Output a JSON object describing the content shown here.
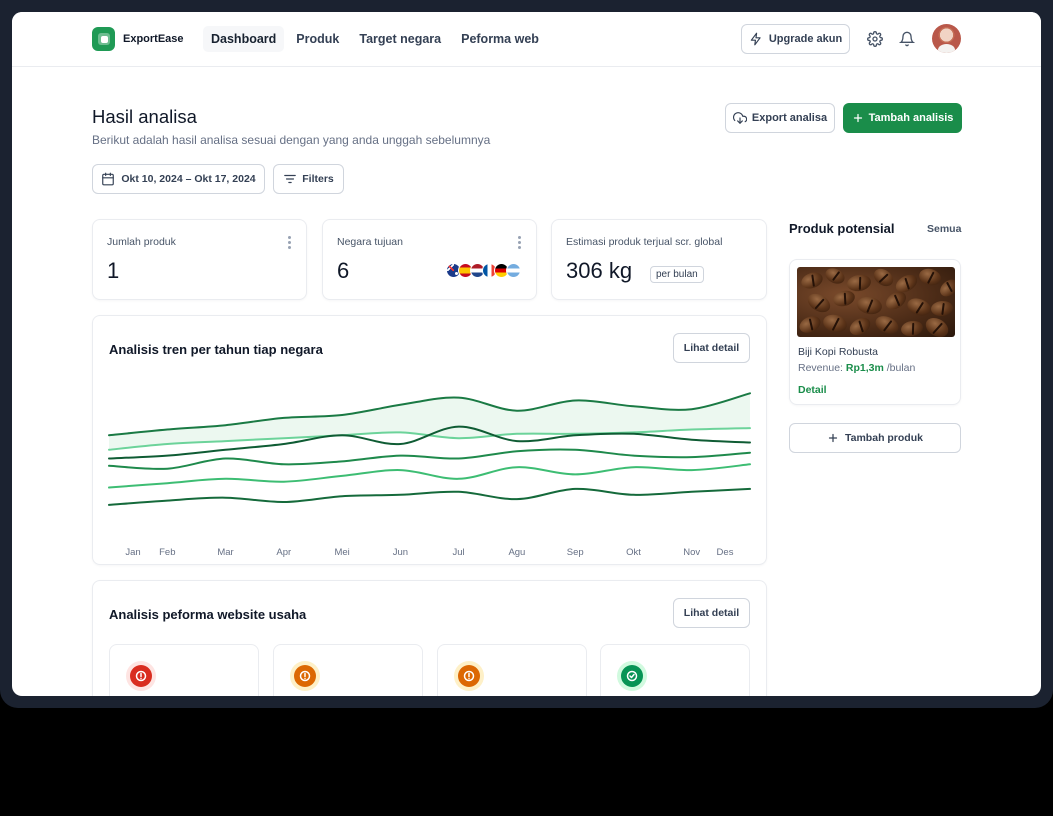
{
  "app": {
    "name": "ExportEase"
  },
  "nav": {
    "links": [
      {
        "label": "Dashboard",
        "active": true
      },
      {
        "label": "Produk",
        "active": false
      },
      {
        "label": "Target negara",
        "active": false
      },
      {
        "label": "Peforma web",
        "active": false
      }
    ],
    "upgrade_label": "Upgrade akun",
    "icons": [
      "settings-icon",
      "bell-icon"
    ]
  },
  "header": {
    "title": "Hasil analisa",
    "subtitle": "Berikut adalah hasil analisa sesuai dengan yang anda unggah sebelumnya",
    "export_label": "Export analisa",
    "add_label": "Tambah analisis",
    "date_range": "Okt 10, 2024 – Okt 17, 2024",
    "filters_label": "Filters"
  },
  "stats": [
    {
      "label": "Jumlah produk",
      "value": "1"
    },
    {
      "label": "Negara tujuan",
      "value": "6",
      "flags": [
        "australia",
        "spain",
        "netherlands",
        "france",
        "germany",
        "argentina"
      ]
    },
    {
      "label": "Estimasi produk terjual scr. global",
      "value": "306 kg",
      "unit_badge": "per bulan"
    }
  ],
  "trend": {
    "title": "Analisis tren per tahun tiap negara",
    "detail_label": "Lihat detail"
  },
  "chart_data": {
    "type": "line",
    "title": "Analisis tren per tahun tiap negara",
    "x": [
      "Jan",
      "Feb",
      "Mar",
      "Apr",
      "Mei",
      "Jun",
      "Jul",
      "Agu",
      "Sep",
      "Okt",
      "Nov",
      "Des"
    ],
    "ylim": [
      0,
      100
    ],
    "grid": false,
    "series": [
      {
        "color": "#1a7a44",
        "values": [
          66,
          70,
          73,
          78,
          80,
          87,
          92,
          83,
          90,
          86,
          84,
          95
        ]
      },
      {
        "color": "#6cd39a",
        "values": [
          56,
          60,
          62,
          64,
          66,
          68,
          64,
          67,
          67,
          68,
          70,
          71
        ]
      },
      {
        "color": "#0f5c34",
        "values": [
          50,
          52,
          56,
          60,
          66,
          60,
          72,
          62,
          66,
          67,
          63,
          61
        ]
      },
      {
        "color": "#1f8a4c",
        "values": [
          45,
          43,
          50,
          46,
          48,
          52,
          50,
          55,
          56,
          52,
          51,
          54
        ]
      },
      {
        "color": "#3dbd73",
        "values": [
          30,
          33,
          36,
          34,
          38,
          42,
          36,
          44,
          39,
          44,
          42,
          46
        ]
      },
      {
        "color": "#156a3b",
        "values": [
          18,
          21,
          23,
          20,
          24,
          25,
          27,
          22,
          29,
          25,
          27,
          29
        ]
      }
    ]
  },
  "web_perf": {
    "title": "Analisis peforma website usaha",
    "detail_label": "Lihat detail",
    "cards": [
      {
        "status": "error",
        "color": "#d92d20",
        "bg": "#fee4e2",
        "icon": "alert-circle-icon"
      },
      {
        "status": "warning",
        "color": "#dc6803",
        "bg": "#fef0c7",
        "icon": "alert-circle-icon"
      },
      {
        "status": "warning",
        "color": "#dc6803",
        "bg": "#fef0c7",
        "icon": "alert-circle-icon"
      },
      {
        "status": "success",
        "color": "#079455",
        "bg": "#d1fadf",
        "icon": "check-circle-icon"
      }
    ]
  },
  "sidebar": {
    "title": "Produk potensial",
    "see_all": "Semua",
    "product": {
      "name": "Biji Kopi Robusta",
      "revenue_prefix": "Revenue: ",
      "revenue_value": "Rp1,3m",
      "revenue_suffix": " /bulan",
      "detail_label": "Detail"
    },
    "add_product_label": "Tambah produk"
  },
  "colors": {
    "primary": "#1a8d4a",
    "frame": "#1b2230"
  }
}
